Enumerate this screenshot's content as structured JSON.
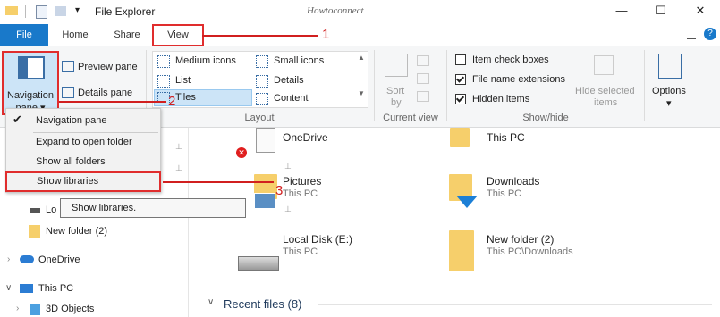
{
  "titlebar": {
    "title": "File Explorer",
    "watermark": "Howtoconnect",
    "minimize": "—",
    "maximize": "☐",
    "close": "✕"
  },
  "tabs": [
    {
      "label": "File"
    },
    {
      "label": "Home"
    },
    {
      "label": "Share"
    },
    {
      "label": "View"
    }
  ],
  "ribbon": {
    "navigation_pane": {
      "label_line1": "Navigation",
      "label_line2": "pane ▾"
    },
    "preview_pane": "Preview pane",
    "details_pane": "Details pane",
    "layout_items": [
      "Medium icons",
      "Small icons",
      "List",
      "Details",
      "Tiles",
      "Content"
    ],
    "layout_group": "Layout",
    "sort_by": {
      "line1": "Sort",
      "line2": "by"
    },
    "current_view_group": "Current view",
    "checkboxes": [
      {
        "label": "Item check boxes",
        "checked": false
      },
      {
        "label": "File name extensions",
        "checked": true
      },
      {
        "label": "Hidden items",
        "checked": true
      }
    ],
    "hide_selected": {
      "line1": "Hide selected",
      "line2": "items"
    },
    "show_hide_group": "Show/hide",
    "options": "Options",
    "options_arrow": "▾"
  },
  "menu": {
    "items": [
      {
        "label": "Navigation pane",
        "checked": true
      },
      {
        "label": "Expand to open folder",
        "checked": false
      },
      {
        "label": "Show all folders",
        "checked": false
      },
      {
        "label": "Show libraries",
        "checked": false
      }
    ],
    "tooltip": "Show libraries."
  },
  "nav_tree": [
    {
      "label": "Lo"
    },
    {
      "label": "New folder (2)"
    },
    {
      "label": "OneDrive"
    },
    {
      "label": "This PC"
    },
    {
      "label": "3D Objects"
    }
  ],
  "files": [
    {
      "name": "OneDrive",
      "sub": ""
    },
    {
      "name": "This PC",
      "sub": ""
    },
    {
      "name": "Pictures",
      "sub": "This PC"
    },
    {
      "name": "Downloads",
      "sub": "This PC"
    },
    {
      "name": "Local Disk (E:)",
      "sub": "This PC"
    },
    {
      "name": "New folder (2)",
      "sub": "This PC\\Downloads"
    }
  ],
  "recent_files": "Recent files (8)",
  "annotations": {
    "n1": "1",
    "n2": "2",
    "n3": "3"
  },
  "colors": {
    "accent": "#1979ca",
    "annotation_red": "#d11f1f",
    "folder": "#f6cf6b"
  }
}
